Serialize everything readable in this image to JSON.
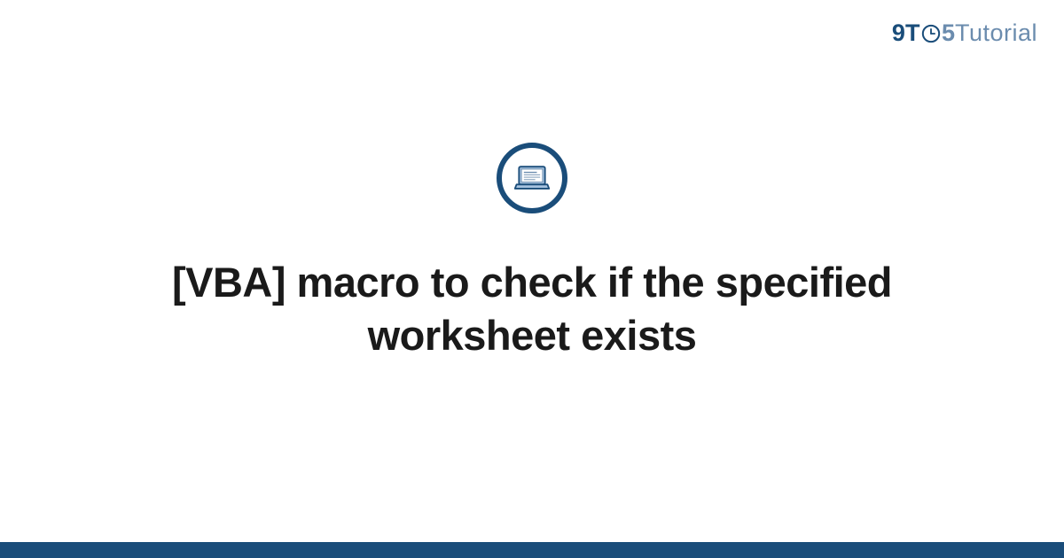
{
  "logo": {
    "part1": "9",
    "part2": "T",
    "part3": "5",
    "part4": "Tutorial"
  },
  "icon": "laptop-icon",
  "title": "[VBA] macro to check if the specified worksheet exists",
  "colors": {
    "primary": "#1a4d7a",
    "secondary": "#6b8cae",
    "iconFill": "#a8c4e0"
  }
}
